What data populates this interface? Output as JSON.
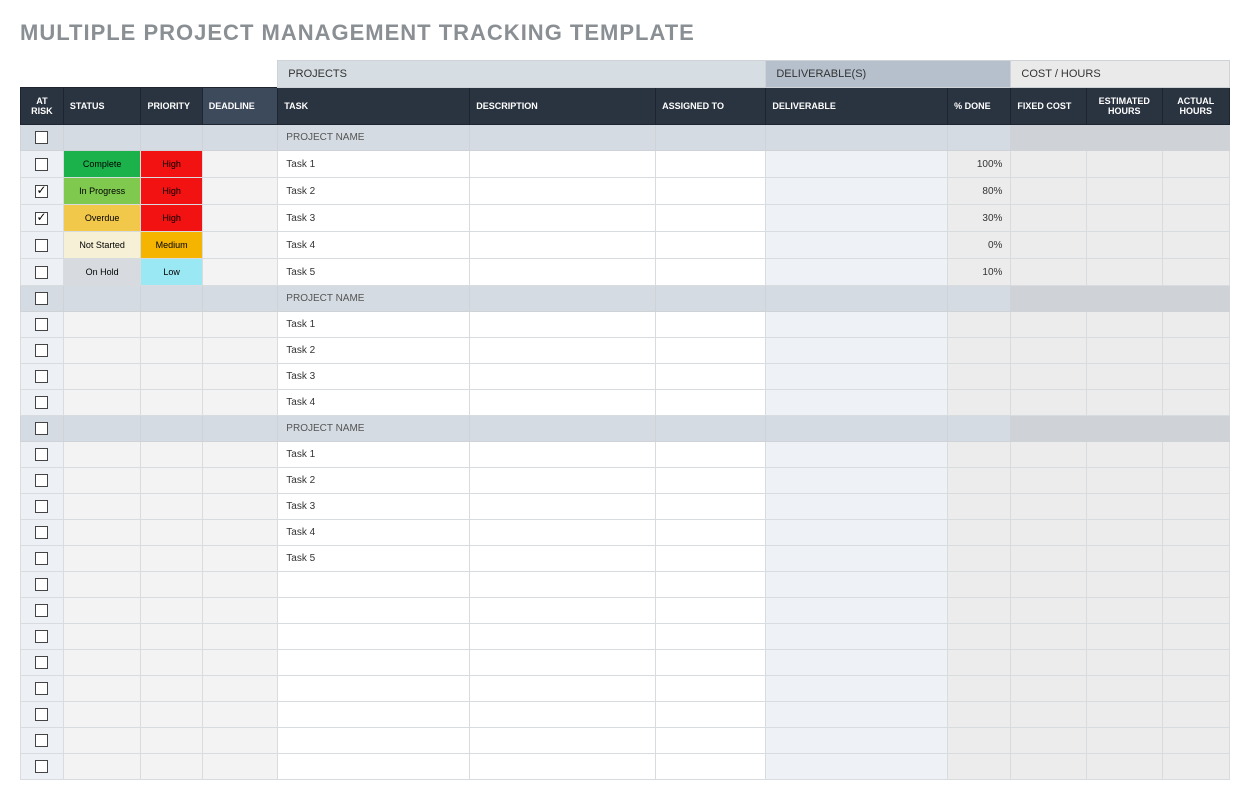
{
  "title": "MULTIPLE PROJECT MANAGEMENT TRACKING TEMPLATE",
  "groups": {
    "projects": "PROJECTS",
    "deliverables": "DELIVERABLE(S)",
    "cost": "COST / HOURS"
  },
  "headers": {
    "atrisk": "AT RISK",
    "status": "STATUS",
    "priority": "PRIORITY",
    "deadline": "DEADLINE",
    "task": "TASK",
    "description": "DESCRIPTION",
    "assigned": "ASSIGNED TO",
    "deliverable": "DELIVERABLE",
    "done": "% DONE",
    "fixed": "FIXED COST",
    "est": "ESTIMATED HOURS",
    "act": "ACTUAL HOURS"
  },
  "status_codes": {
    "complete": "Complete",
    "inprogress": "In Progress",
    "overdue": "Overdue",
    "notstarted": "Not Started",
    "onhold": "On Hold"
  },
  "priority_codes": {
    "high": "High",
    "medium": "Medium",
    "low": "Low"
  },
  "rows": [
    {
      "type": "project",
      "task": "PROJECT NAME"
    },
    {
      "type": "task",
      "checked": false,
      "status": "complete",
      "priority": "high",
      "task": "Task 1",
      "done": "100%"
    },
    {
      "type": "task",
      "checked": true,
      "status": "inprogress",
      "priority": "high",
      "task": "Task 2",
      "done": "80%"
    },
    {
      "type": "task",
      "checked": true,
      "status": "overdue",
      "priority": "high",
      "task": "Task 3",
      "done": "30%"
    },
    {
      "type": "task",
      "checked": false,
      "status": "notstarted",
      "priority": "medium",
      "task": "Task 4",
      "done": "0%"
    },
    {
      "type": "task",
      "checked": false,
      "status": "onhold",
      "priority": "low",
      "task": "Task 5",
      "done": "10%"
    },
    {
      "type": "project",
      "task": "PROJECT NAME"
    },
    {
      "type": "task",
      "checked": false,
      "task": "Task 1"
    },
    {
      "type": "task",
      "checked": false,
      "task": "Task 2"
    },
    {
      "type": "task",
      "checked": false,
      "task": "Task 3"
    },
    {
      "type": "task",
      "checked": false,
      "task": "Task 4"
    },
    {
      "type": "project",
      "task": "PROJECT NAME"
    },
    {
      "type": "task",
      "checked": false,
      "task": "Task 1"
    },
    {
      "type": "task",
      "checked": false,
      "task": "Task 2"
    },
    {
      "type": "task",
      "checked": false,
      "task": "Task 3"
    },
    {
      "type": "task",
      "checked": false,
      "task": "Task 4"
    },
    {
      "type": "task",
      "checked": false,
      "task": "Task 5"
    },
    {
      "type": "task",
      "checked": false
    },
    {
      "type": "task",
      "checked": false
    },
    {
      "type": "task",
      "checked": false
    },
    {
      "type": "task",
      "checked": false
    },
    {
      "type": "task",
      "checked": false
    },
    {
      "type": "task",
      "checked": false
    },
    {
      "type": "task",
      "checked": false
    },
    {
      "type": "task",
      "checked": false
    }
  ]
}
